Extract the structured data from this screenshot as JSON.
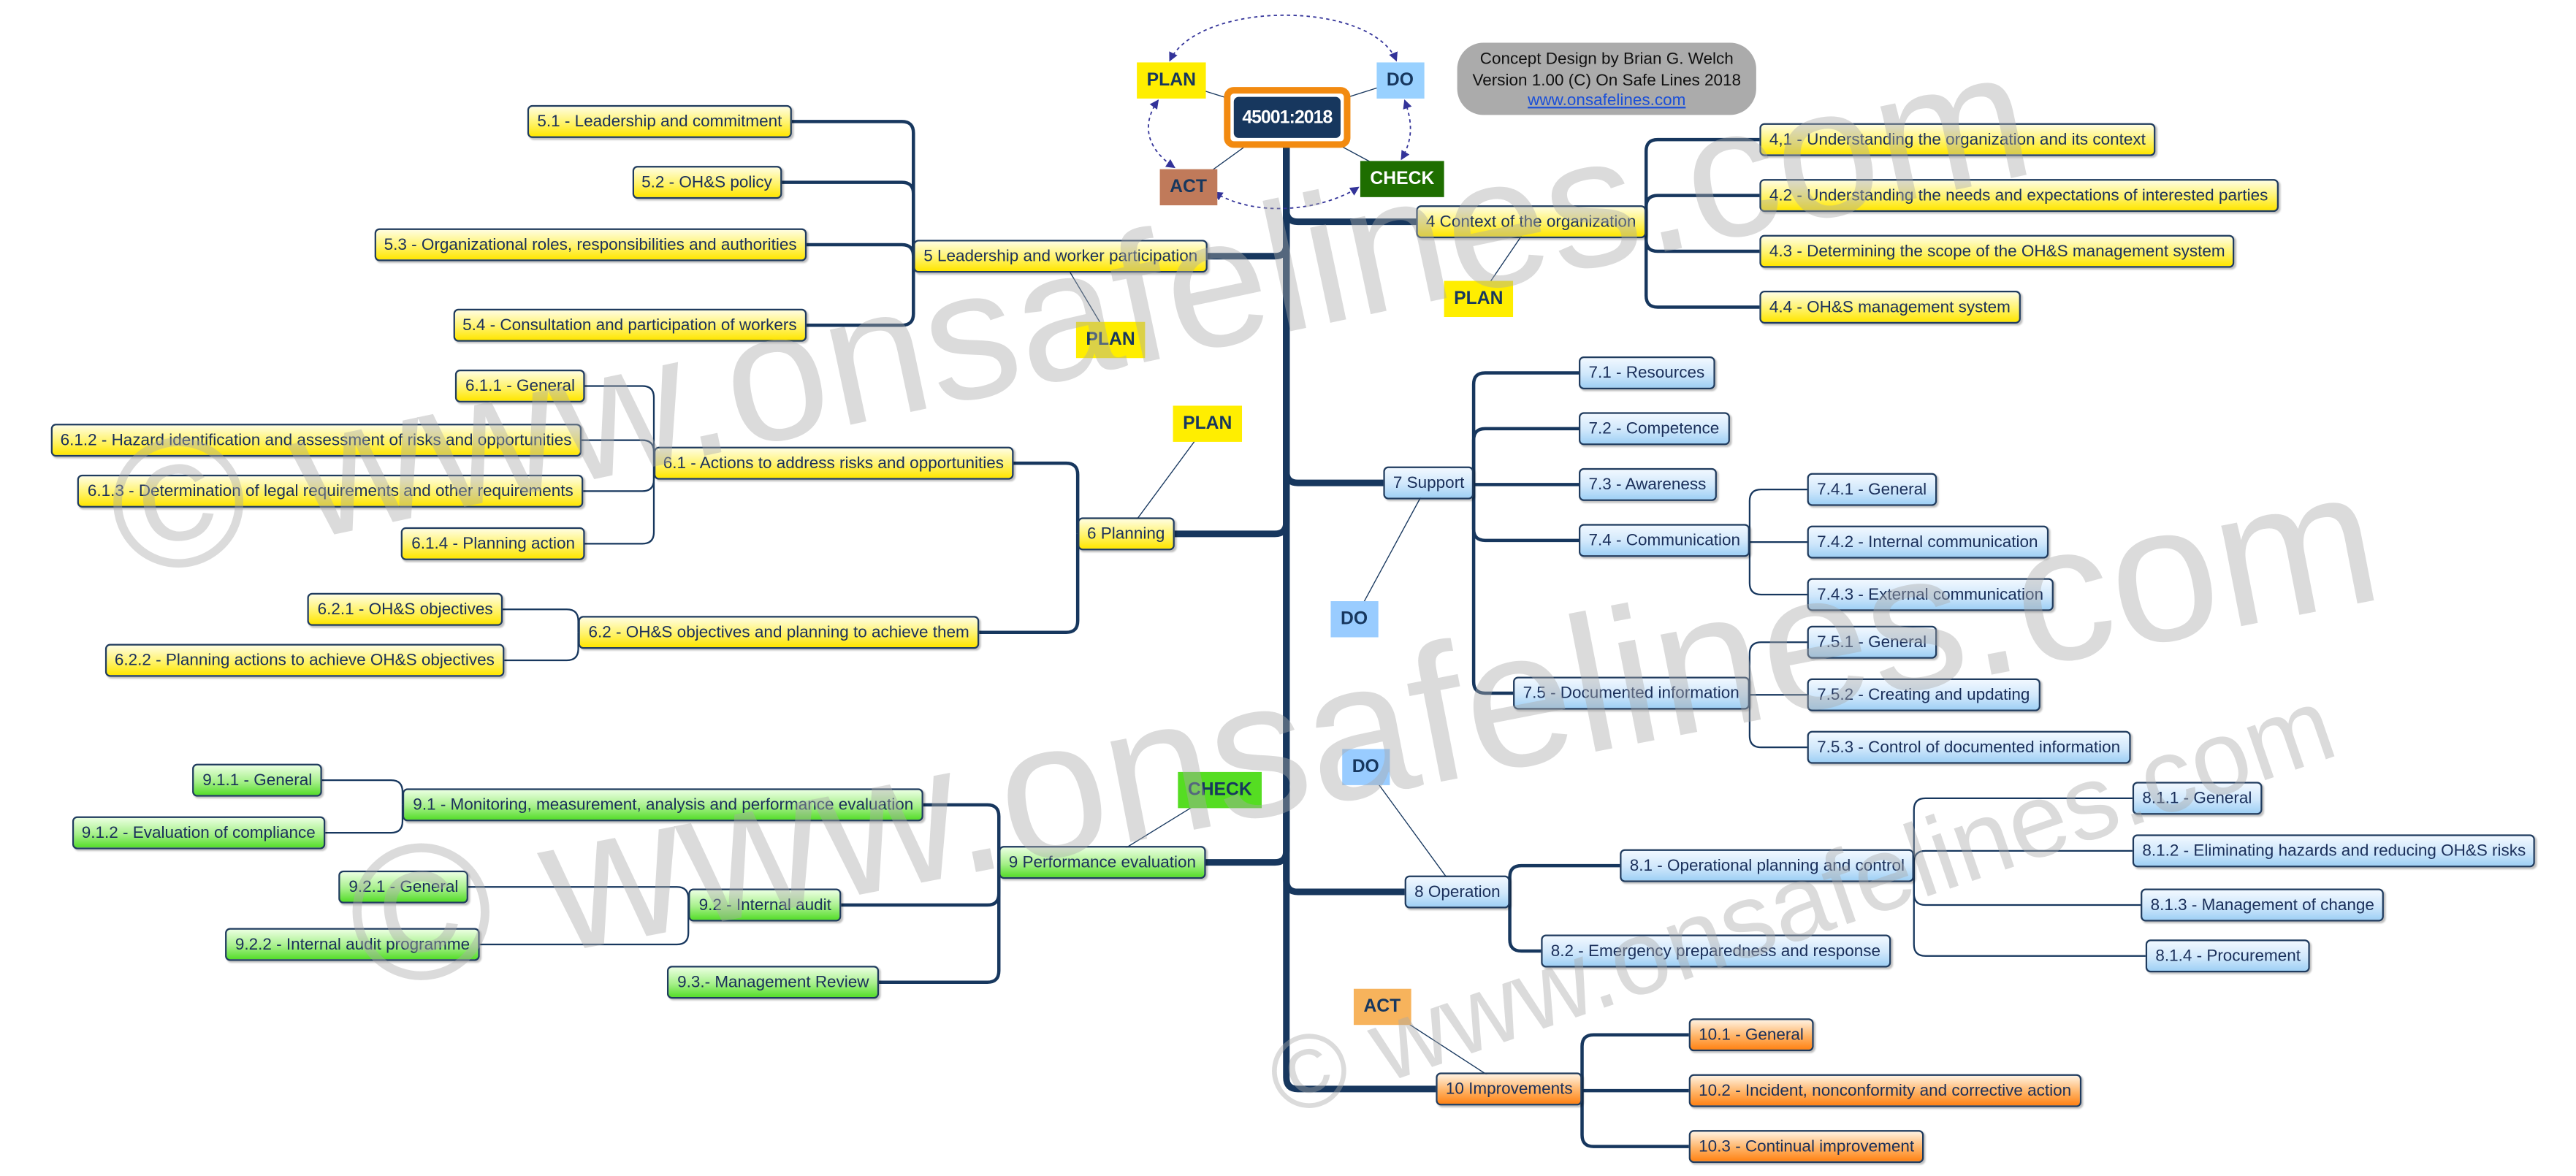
{
  "root": {
    "label": "45001:2018"
  },
  "pdca": [
    {
      "label": "PLAN",
      "color": "#ffee00",
      "text_color": "#17375e"
    },
    {
      "label": "DO",
      "color": "#99d1ff",
      "text_color": "#17375e"
    },
    {
      "label": "CHECK",
      "color": "#1e6e00",
      "text_color": "#ffffff"
    },
    {
      "label": "ACT",
      "color": "#c07a5a",
      "text_color": "#17375e"
    }
  ],
  "credit": {
    "line1": "Concept Design by Brian G. Welch",
    "line2": "Version 1.00 (C) On Safe Lines 2018",
    "link": "www.onsafelines.com"
  },
  "watermark": "© www.onsafelines.com",
  "colors": {
    "connector": "#17375e",
    "arrow": "#333399",
    "tag_plan": "#ffee00",
    "tag_do": "#99ccff",
    "tag_check": "#55dd22",
    "tag_act": "#f7b35c"
  },
  "branches": [
    {
      "label": "4 Context of the organization",
      "style": "yellow",
      "tag": "PLAN",
      "tag_color": "#ffee00",
      "children": [
        {
          "label": "4,1 - Understanding the organization and its context"
        },
        {
          "label": "4.2 - Understanding the needs and expectations of interested parties"
        },
        {
          "label": "4.3 - Determining the scope of the OH&S management system"
        },
        {
          "label": "4.4 - OH&S management system"
        }
      ]
    },
    {
      "label": "5 Leadership and worker participation",
      "style": "yellow",
      "tag": "PLAN",
      "tag_color": "#ffee00",
      "children": [
        {
          "label": "5.1 - Leadership and commitment"
        },
        {
          "label": "5.2 - OH&S policy"
        },
        {
          "label": "5.3 - Organizational roles, responsibilities and authorities"
        },
        {
          "label": "5.4 - Consultation and participation of workers"
        }
      ]
    },
    {
      "label": "6 Planning",
      "style": "yellow",
      "tag": "PLAN",
      "tag_color": "#ffee00",
      "children": [
        {
          "label": "6.1 - Actions to address risks and opportunities",
          "children": [
            {
              "label": "6.1.1 - General"
            },
            {
              "label": "6.1.2 - Hazard identification and assessment of risks and opportunities"
            },
            {
              "label": "6.1.3 - Determination of legal requirements and other requirements"
            },
            {
              "label": "6.1.4 - Planning action"
            }
          ]
        },
        {
          "label": "6.2 - OH&S objectives and planning to achieve them",
          "children": [
            {
              "label": "6.2.1 - OH&S objectives"
            },
            {
              "label": "6.2.2 - Planning actions to achieve OH&S objectives"
            }
          ]
        }
      ]
    },
    {
      "label": "7 Support",
      "style": "blue",
      "tag": "DO",
      "tag_color": "#99ccff",
      "children": [
        {
          "label": "7.1 - Resources"
        },
        {
          "label": "7.2 - Competence"
        },
        {
          "label": "7.3 - Awareness"
        },
        {
          "label": "7.4 - Communication",
          "children": [
            {
              "label": "7.4.1 - General"
            },
            {
              "label": "7.4.2 - Internal communication"
            },
            {
              "label": "7.4.3 - External communication"
            }
          ]
        },
        {
          "label": "7.5 - Documented information",
          "children": [
            {
              "label": "7.5.1 - General"
            },
            {
              "label": "7.5.2 - Creating and updating"
            },
            {
              "label": "7.5.3 - Control of documented information"
            }
          ]
        }
      ]
    },
    {
      "label": "8 Operation",
      "style": "blue",
      "tag": "DO",
      "tag_color": "#99ccff",
      "children": [
        {
          "label": "8.1 - Operational planning and control",
          "children": [
            {
              "label": "8.1.1 - General"
            },
            {
              "label": "8.1.2 - Eliminating hazards and reducing OH&S risks"
            },
            {
              "label": "8.1.3 - Management of change"
            },
            {
              "label": "8.1.4 - Procurement"
            }
          ]
        },
        {
          "label": "8.2 - Emergency preparedness and response"
        }
      ]
    },
    {
      "label": "9 Performance evaluation",
      "style": "green",
      "tag": "CHECK",
      "tag_color": "#55dd22",
      "children": [
        {
          "label": "9.1 - Monitoring, measurement, analysis and performance evaluation",
          "children": [
            {
              "label": "9.1.1 - General"
            },
            {
              "label": "9.1.2 - Evaluation of compliance"
            }
          ]
        },
        {
          "label": "9.2 - Internal audit",
          "children": [
            {
              "label": "9.2.1 - General"
            },
            {
              "label": "9.2.2 - Internal audit programme"
            }
          ]
        },
        {
          "label": "9.3.- Management Review"
        }
      ]
    },
    {
      "label": "10 Improvements",
      "style": "orange",
      "tag": "ACT",
      "tag_color": "#f7b35c",
      "children": [
        {
          "label": "10.1 - General"
        },
        {
          "label": "10.2 - Incident, nonconformity and corrective action"
        },
        {
          "label": "10.3 - Continual improvement"
        }
      ]
    }
  ]
}
